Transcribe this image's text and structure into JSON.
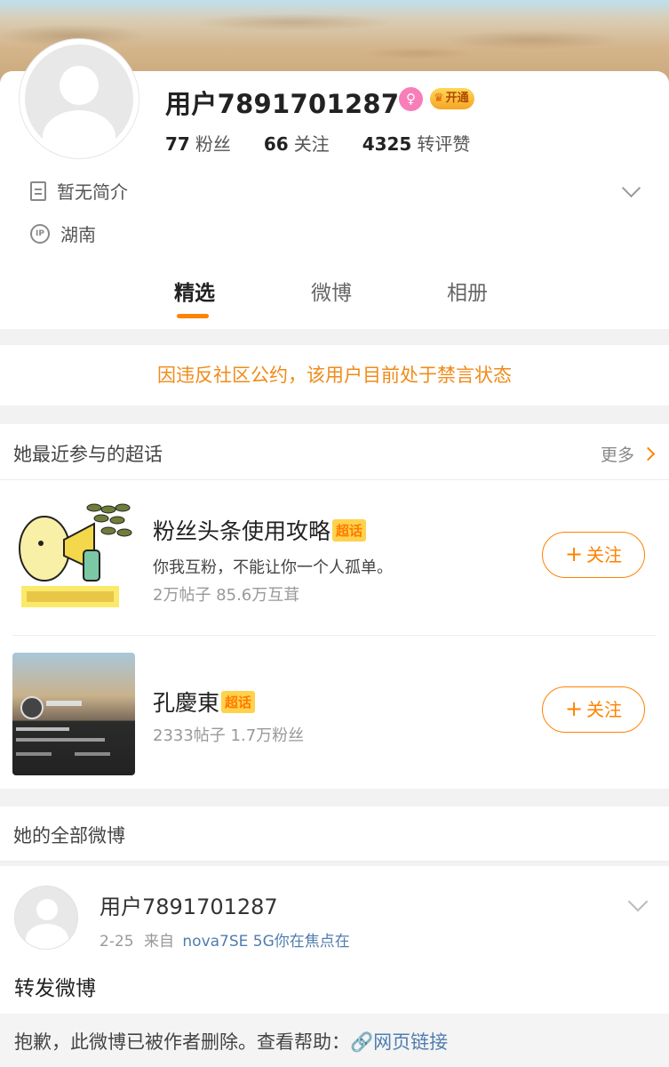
{
  "profile": {
    "username": "用户7891701287",
    "gender_icon": "female-icon",
    "vip_label": "开通",
    "stats": [
      {
        "num": "77",
        "label": "粉丝"
      },
      {
        "num": "66",
        "label": "关注"
      },
      {
        "num": "4325",
        "label": "转评赞"
      }
    ],
    "intro": "暂无简介",
    "ip": "湖南",
    "ip_icon_text": "IP"
  },
  "tabs": [
    "精选",
    "微博",
    "相册"
  ],
  "ban_notice": "因违反社区公约，该用户目前处于禁言状态",
  "topics": {
    "header": "她最近参与的超话",
    "more": "更多",
    "badge": "超话",
    "follow": "关注",
    "follow_plus": "+",
    "items": [
      {
        "title": "粉丝头条使用攻略",
        "desc": "你我互粉，不能让你一个人孤单。",
        "meta": "2万帖子 85.6万互茸"
      },
      {
        "title": "孔慶東",
        "desc": "",
        "meta": "2333帖子 1.7万粉丝"
      }
    ]
  },
  "all_weibo": "她的全部微博",
  "post": {
    "user": "用户7891701287",
    "date": "2-25",
    "from": "来自",
    "source": "nova7SE 5G你在焦点在",
    "text": "转发微博",
    "deleted_msg": "抱歉，此微博已被作者删除。查看帮助：",
    "link_label": "网页链接"
  },
  "colors": {
    "accent": "#ff8200",
    "ban": "#f08b19",
    "link": "#507daf"
  }
}
